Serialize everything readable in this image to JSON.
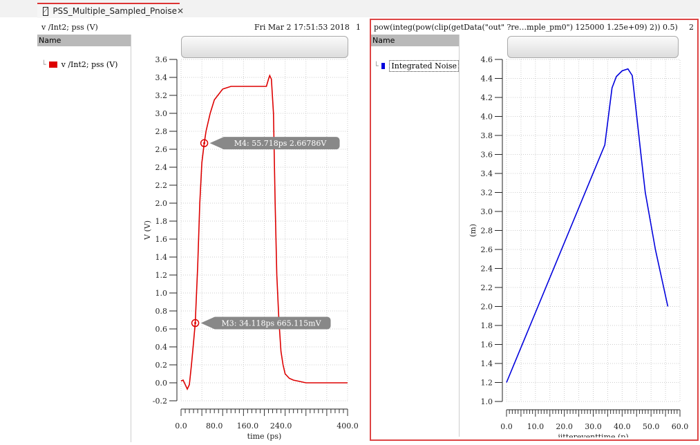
{
  "tab": {
    "title": "PSS_Multiple_Sampled_Pnoise",
    "close": "✕"
  },
  "left": {
    "title": "v /Int2; pss (V)",
    "timestamp": "Fri Mar 2 17:51:53 2018",
    "index": "1",
    "name_header": "Name",
    "legend": "v /Int2; pss (V)",
    "color": "#dd0000",
    "markers": [
      {
        "label": "M4: 55.718ps 2.66786V",
        "x": 55.718,
        "y": 2.66786
      },
      {
        "label": "M3: 34.118ps 665.115mV",
        "x": 34.118,
        "y": 0.665115
      }
    ]
  },
  "right": {
    "title": "pow(integ(pow(clip(getData(\"out\" ?re…mple_pm0\") 125000 1.25e+09) 2)) 0.5)",
    "index": "2",
    "name_header": "Name",
    "legend": "Integrated Noise",
    "color": "#0000dd"
  },
  "chart_data": [
    {
      "type": "line",
      "xlabel": "time (ps)",
      "ylabel": "V (V)",
      "xlim": [
        0,
        400
      ],
      "ylim": [
        -0.2,
        3.6
      ],
      "xticks": [
        "0.0",
        "80.0",
        "160.0",
        "240.0",
        "400.0"
      ],
      "xtick_values": [
        0,
        80,
        160,
        240,
        400
      ],
      "yticks": [
        "-0.2",
        "0.0",
        "0.2",
        "0.4",
        "0.6",
        "0.8",
        "1.0",
        "1.2",
        "1.4",
        "1.6",
        "1.8",
        "2.0",
        "2.2",
        "2.4",
        "2.6",
        "2.8",
        "3.0",
        "3.2",
        "3.4",
        "3.6"
      ],
      "series": [
        {
          "name": "v /Int2; pss (V)",
          "x": [
            0,
            5,
            10,
            15,
            20,
            25,
            30,
            34.1,
            40,
            45,
            50,
            55.7,
            60,
            70,
            80,
            100,
            120,
            140,
            180,
            205,
            210,
            213,
            217,
            222,
            226,
            230,
            235,
            240,
            245,
            250,
            260,
            270,
            280,
            300,
            350,
            400
          ],
          "y": [
            0.02,
            0.03,
            -0.02,
            -0.07,
            -0.02,
            0.2,
            0.45,
            0.665,
            1.3,
            2.0,
            2.45,
            2.668,
            2.8,
            3.0,
            3.15,
            3.27,
            3.3,
            3.3,
            3.3,
            3.3,
            3.38,
            3.42,
            3.38,
            3.0,
            2.0,
            1.2,
            0.7,
            0.35,
            0.2,
            0.1,
            0.05,
            0.03,
            0.02,
            0.0,
            0.0,
            0.0
          ]
        }
      ]
    },
    {
      "type": "line",
      "xlabel": "jittereventtime (p)",
      "ylabel": "(m)",
      "xlim": [
        0,
        60
      ],
      "ylim": [
        1.0,
        4.6
      ],
      "xticks": [
        "0.0",
        "10.0",
        "20.0",
        "30.0",
        "40.0",
        "50.0",
        "60.0"
      ],
      "xtick_values": [
        0,
        10,
        20,
        30,
        40,
        50,
        60
      ],
      "yticks": [
        "1.0",
        "1.2",
        "1.4",
        "1.6",
        "1.8",
        "2.0",
        "2.2",
        "2.4",
        "2.6",
        "2.8",
        "3.0",
        "3.2",
        "3.4",
        "3.6",
        "3.8",
        "4.0",
        "4.2",
        "4.4",
        "4.6"
      ],
      "series": [
        {
          "name": "Integrated Noise",
          "x": [
            0,
            34,
            36.5,
            38,
            40,
            42,
            43.5,
            46.5,
            48,
            51.5,
            55.8
          ],
          "y": [
            1.2,
            3.7,
            4.3,
            4.42,
            4.48,
            4.5,
            4.43,
            3.6,
            3.2,
            2.6,
            2.0
          ]
        }
      ]
    }
  ]
}
